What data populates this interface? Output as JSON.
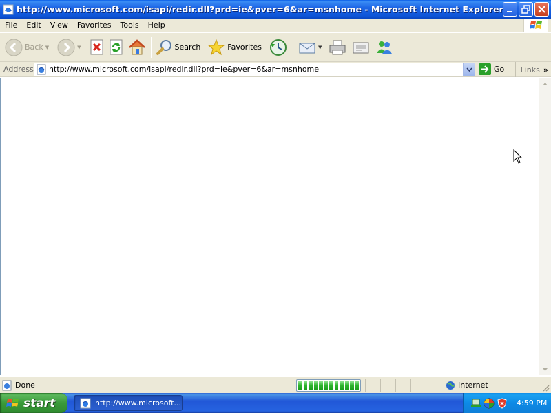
{
  "window": {
    "title": "http://www.microsoft.com/isapi/redir.dll?prd=ie&pver=6&ar=msnhome - Microsoft Internet Explorer"
  },
  "menubar": {
    "items": [
      "File",
      "Edit",
      "View",
      "Favorites",
      "Tools",
      "Help"
    ]
  },
  "toolbar": {
    "back_label": "Back",
    "search_label": "Search",
    "favorites_label": "Favorites"
  },
  "addressbar": {
    "label": "Address",
    "url": "http://www.microsoft.com/isapi/redir.dll?prd=ie&pver=6&ar=msnhome",
    "go_label": "Go",
    "links_label": "Links"
  },
  "statusbar": {
    "status_text": "Done",
    "progress": 1.0,
    "progress_blocks": 12,
    "zone_label": "Internet"
  },
  "taskbar": {
    "start_label": "start",
    "task_label": "http://www.microsoft...",
    "clock": "4:59 PM"
  },
  "colors": {
    "titlebar_blue": "#0e55d8",
    "chrome_beige": "#ece9d8",
    "start_green": "#3a9a3a",
    "progress_green": "#2fb52f"
  }
}
